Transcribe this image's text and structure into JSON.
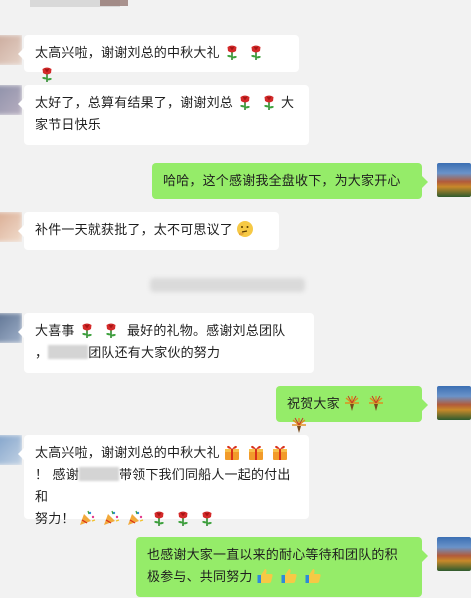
{
  "chat": {
    "messages": [
      {
        "side": "left",
        "text": "太高兴啦，谢谢刘总的中秋大礼"
      },
      {
        "side": "left",
        "line1": "太好了，总算有结果了，谢谢刘总",
        "line1b": "大",
        "line2": "家节日快乐"
      },
      {
        "side": "right",
        "text": "哈哈，这个感谢我全盘收下，为大家开心"
      },
      {
        "side": "left",
        "text": "补件一天就获批了，太不可思议了"
      },
      {
        "side": "left",
        "line1a": "大喜事",
        "line1b": "最好的礼物。感谢刘总团队",
        "line2a": "，",
        "line2b": "团队还有大家伙的努力"
      },
      {
        "side": "right",
        "text": "祝贺大家"
      },
      {
        "side": "left",
        "line1": "太高兴啦，谢谢刘总的中秋大礼",
        "line2a": "！ 感谢",
        "line2b": "带领下我们同船人一起的付出和",
        "line3": "努力！"
      },
      {
        "side": "right",
        "line1": "也感谢大家一直以来的耐心等待和团队的积",
        "line2": "极参与、共同努力"
      }
    ]
  },
  "icons": {
    "rose": "rose-icon",
    "smirk": "thinking-face-icon",
    "fireworks": "fireworks-icon",
    "gift": "gift-icon",
    "party": "party-popper-icon",
    "thumb": "thumbs-up-icon"
  },
  "colors": {
    "my_bubble": "#95ec69",
    "their_bubble": "#ffffff",
    "background": "#f2f2f2"
  }
}
